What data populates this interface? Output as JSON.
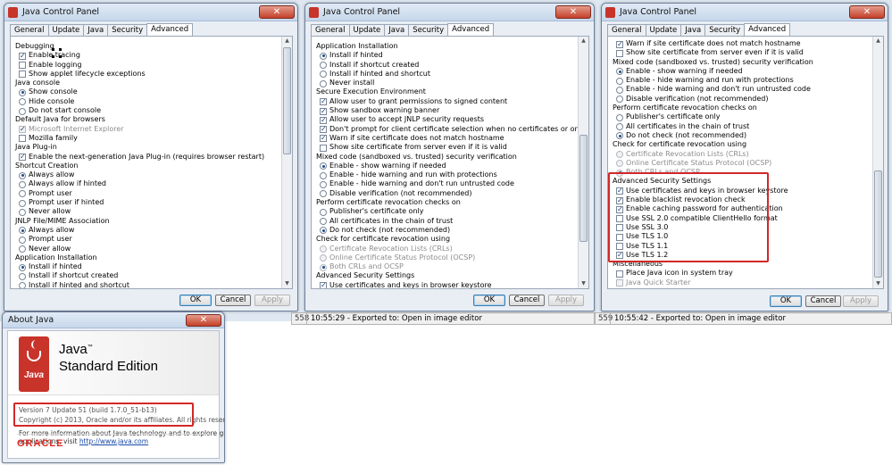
{
  "window_title": "Java Control Panel",
  "tabs": [
    "General",
    "Update",
    "Java",
    "Security",
    "Advanced"
  ],
  "buttons": {
    "ok": "OK",
    "cancel": "Cancel",
    "apply": "Apply"
  },
  "status": {
    "prefix": "558",
    "prefix2": "559",
    "msg1": "10:55:29 - Exported to: Open in image editor",
    "msg2": "10:55:42 - Exported to: Open in image editor"
  },
  "panel1": [
    {
      "t": "cat",
      "label": "Debugging"
    },
    {
      "t": "chk",
      "label": "Enable tracing",
      "on": true
    },
    {
      "t": "chk",
      "label": "Enable logging",
      "on": false
    },
    {
      "t": "chk",
      "label": "Show applet lifecycle exceptions",
      "on": false
    },
    {
      "t": "cat",
      "label": "Java console"
    },
    {
      "t": "rad",
      "label": "Show console",
      "on": true
    },
    {
      "t": "rad",
      "label": "Hide console",
      "on": false
    },
    {
      "t": "rad",
      "label": "Do not start console",
      "on": false
    },
    {
      "t": "cat",
      "label": "Default Java for browsers"
    },
    {
      "t": "chk",
      "label": "Microsoft Internet Explorer",
      "on": true,
      "dis": true
    },
    {
      "t": "chk",
      "label": "Mozilla family",
      "on": false
    },
    {
      "t": "cat",
      "label": "Java Plug-in"
    },
    {
      "t": "chk",
      "label": "Enable the next-generation Java Plug-in (requires browser restart)",
      "on": true
    },
    {
      "t": "cat",
      "label": "Shortcut Creation"
    },
    {
      "t": "rad",
      "label": "Always allow",
      "on": true
    },
    {
      "t": "rad",
      "label": "Always allow if hinted",
      "on": false
    },
    {
      "t": "rad",
      "label": "Prompt user",
      "on": false
    },
    {
      "t": "rad",
      "label": "Prompt user if hinted",
      "on": false
    },
    {
      "t": "rad",
      "label": "Never allow",
      "on": false
    },
    {
      "t": "cat",
      "label": "JNLP File/MIME Association"
    },
    {
      "t": "rad",
      "label": "Always allow",
      "on": true
    },
    {
      "t": "rad",
      "label": "Prompt user",
      "on": false
    },
    {
      "t": "rad",
      "label": "Never allow",
      "on": false
    },
    {
      "t": "cat",
      "label": "Application Installation"
    },
    {
      "t": "rad",
      "label": "Install if hinted",
      "on": true
    },
    {
      "t": "rad",
      "label": "Install if shortcut created",
      "on": false
    },
    {
      "t": "rad",
      "label": "Install if hinted and shortcut",
      "on": false
    }
  ],
  "panel2": [
    {
      "t": "cat",
      "label": "Application Installation"
    },
    {
      "t": "rad",
      "label": "Install if hinted",
      "on": true
    },
    {
      "t": "rad",
      "label": "Install if shortcut created",
      "on": false
    },
    {
      "t": "rad",
      "label": "Install if hinted and shortcut",
      "on": false
    },
    {
      "t": "rad",
      "label": "Never install",
      "on": false
    },
    {
      "t": "cat",
      "label": "Secure Execution Environment"
    },
    {
      "t": "chk",
      "label": "Allow user to grant permissions to signed content",
      "on": true
    },
    {
      "t": "chk",
      "label": "Show sandbox warning banner",
      "on": true
    },
    {
      "t": "chk",
      "label": "Allow user to accept JNLP security requests",
      "on": true
    },
    {
      "t": "chk",
      "label": "Don't prompt for client certificate selection when no certificates or only one exists",
      "on": true
    },
    {
      "t": "chk",
      "label": "Warn if site certificate does not match hostname",
      "on": true
    },
    {
      "t": "chk",
      "label": "Show site certificate from server even if it is valid",
      "on": false
    },
    {
      "t": "cat",
      "label": "Mixed code (sandboxed vs. trusted) security verification"
    },
    {
      "t": "rad",
      "label": "Enable - show warning if needed",
      "on": true
    },
    {
      "t": "rad",
      "label": "Enable - hide warning and run with protections",
      "on": false
    },
    {
      "t": "rad",
      "label": "Enable - hide warning and don't run untrusted code",
      "on": false
    },
    {
      "t": "rad",
      "label": "Disable verification (not recommended)",
      "on": false
    },
    {
      "t": "cat",
      "label": "Perform certificate revocation checks on"
    },
    {
      "t": "rad",
      "label": "Publisher's certificate only",
      "on": false
    },
    {
      "t": "rad",
      "label": "All certificates in the chain of trust",
      "on": false
    },
    {
      "t": "rad",
      "label": "Do not check (not recommended)",
      "on": true
    },
    {
      "t": "cat",
      "label": "Check for certificate revocation using"
    },
    {
      "t": "rad",
      "label": "Certificate Revocation Lists (CRLs)",
      "on": false,
      "dis": true
    },
    {
      "t": "rad",
      "label": "Online Certificate Status Protocol (OCSP)",
      "on": false,
      "dis": true
    },
    {
      "t": "rad",
      "label": "Both CRLs and OCSP",
      "on": true,
      "dis": true
    },
    {
      "t": "cat",
      "label": "Advanced Security Settings"
    },
    {
      "t": "chk",
      "label": "Use certificates and keys in browser keystore",
      "on": true
    }
  ],
  "panel3": [
    {
      "t": "chk",
      "label": "Warn if site certificate does not match hostname",
      "on": true
    },
    {
      "t": "chk",
      "label": "Show site certificate from server even if it is valid",
      "on": false
    },
    {
      "t": "cat",
      "label": "Mixed code (sandboxed vs. trusted) security verification"
    },
    {
      "t": "rad",
      "label": "Enable - show warning if needed",
      "on": true
    },
    {
      "t": "rad",
      "label": "Enable - hide warning and run with protections",
      "on": false
    },
    {
      "t": "rad",
      "label": "Enable - hide warning and don't run untrusted code",
      "on": false
    },
    {
      "t": "rad",
      "label": "Disable verification (not recommended)",
      "on": false
    },
    {
      "t": "cat",
      "label": "Perform certificate revocation checks on"
    },
    {
      "t": "rad",
      "label": "Publisher's certificate only",
      "on": false
    },
    {
      "t": "rad",
      "label": "All certificates in the chain of trust",
      "on": false
    },
    {
      "t": "rad",
      "label": "Do not check (not recommended)",
      "on": true
    },
    {
      "t": "cat",
      "label": "Check for certificate revocation using"
    },
    {
      "t": "rad",
      "label": "Certificate Revocation Lists (CRLs)",
      "on": false,
      "dis": true
    },
    {
      "t": "rad",
      "label": "Online Certificate Status Protocol (OCSP)",
      "on": false,
      "dis": true
    },
    {
      "t": "rad",
      "label": "Both CRLs and OCSP",
      "on": true,
      "dis": true
    },
    {
      "t": "cat",
      "label": "Advanced Security Settings"
    },
    {
      "t": "chk",
      "label": "Use certificates and keys in browser keystore",
      "on": true
    },
    {
      "t": "chk",
      "label": "Enable blacklist revocation check",
      "on": true
    },
    {
      "t": "chk",
      "label": "Enable caching password for authentication",
      "on": true
    },
    {
      "t": "chk",
      "label": "Use SSL 2.0 compatible ClientHello format",
      "on": false
    },
    {
      "t": "chk",
      "label": "Use SSL 3.0",
      "on": false
    },
    {
      "t": "chk",
      "label": "Use TLS 1.0",
      "on": false
    },
    {
      "t": "chk",
      "label": "Use TLS 1.1",
      "on": false
    },
    {
      "t": "chk",
      "label": "Use TLS 1.2",
      "on": true
    },
    {
      "t": "cat",
      "label": "Miscellaneous"
    },
    {
      "t": "chk",
      "label": "Place Java icon in system tray",
      "on": false
    },
    {
      "t": "chk",
      "label": "Java Quick Starter",
      "on": false,
      "dis": true
    }
  ],
  "about": {
    "title": "About Java",
    "logo_text": "Java",
    "product_line1": "Java",
    "tm": "™",
    "product_line2": "Standard Edition",
    "version": "Version 7 Update 51   (build 1.7.0_51-b13)",
    "copyright": "Copyright (c) 2013, Oracle and/or its affiliates. All rights reserved.",
    "more1": "For more information about Java technology and to explore great Java",
    "more2_prefix": "applications, visit ",
    "link": "http://www.java.com",
    "oracle": "ORACLE"
  }
}
